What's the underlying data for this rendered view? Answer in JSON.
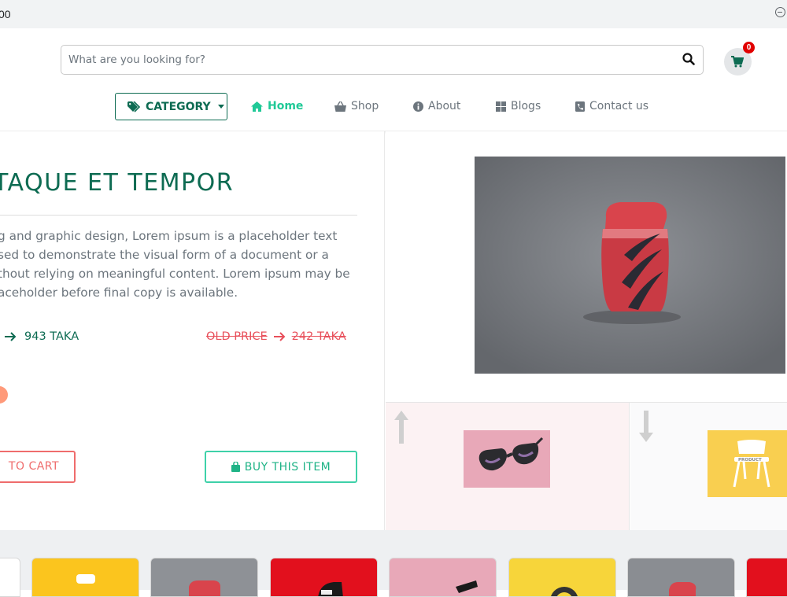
{
  "browser": {
    "url_fragment": "00"
  },
  "search": {
    "placeholder": "What are you looking for?"
  },
  "cart": {
    "count": "0"
  },
  "nav": {
    "category_label": "CATEGORY",
    "items": [
      {
        "label": "Home",
        "icon": "home-icon",
        "active": true
      },
      {
        "label": "Shop",
        "icon": "basket-icon"
      },
      {
        "label": "About",
        "icon": "info-icon"
      },
      {
        "label": "Blogs",
        "icon": "grid-icon"
      },
      {
        "label": "Contact us",
        "icon": "phone-icon"
      }
    ]
  },
  "product": {
    "title": "TAQUE ET TEMPOR",
    "description_lines": [
      "g and graphic design, Lorem ipsum is a placeholder text",
      "sed to demonstrate the visual form of a document or a",
      "thout relying on meaningful content. Lorem ipsum may be",
      "aceholder before final copy is available."
    ],
    "new_price": "943 TAKA",
    "old_price_label": "OLD PRICE",
    "old_price": "242 TAKA",
    "add_to_cart_label": "TO CART",
    "buy_label": "BUY THIS ITEM"
  },
  "thumbs": {
    "chair_tag": "PRODUCT"
  },
  "colors": {
    "brand_green": "#0d6b52",
    "accent_teal": "#20c997",
    "sale_red": "#e8505b",
    "badge_red": "#e10000"
  }
}
